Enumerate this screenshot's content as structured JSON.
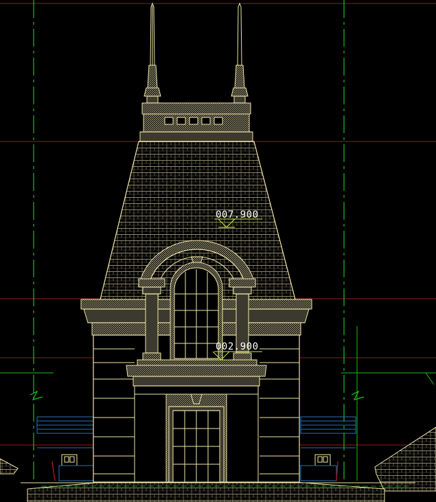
{
  "drawing": {
    "background": "#000000",
    "colors": {
      "line": "#f2e7a6",
      "hatch": "#bfb88e",
      "grid_green": "#18c21e",
      "grid_red": "#a1161a",
      "level_mark": "#c8f23a",
      "window_blue": "#2d6fc0",
      "label": "#ffffff"
    },
    "elevation_labels": [
      "007.900",
      "002.900"
    ]
  }
}
